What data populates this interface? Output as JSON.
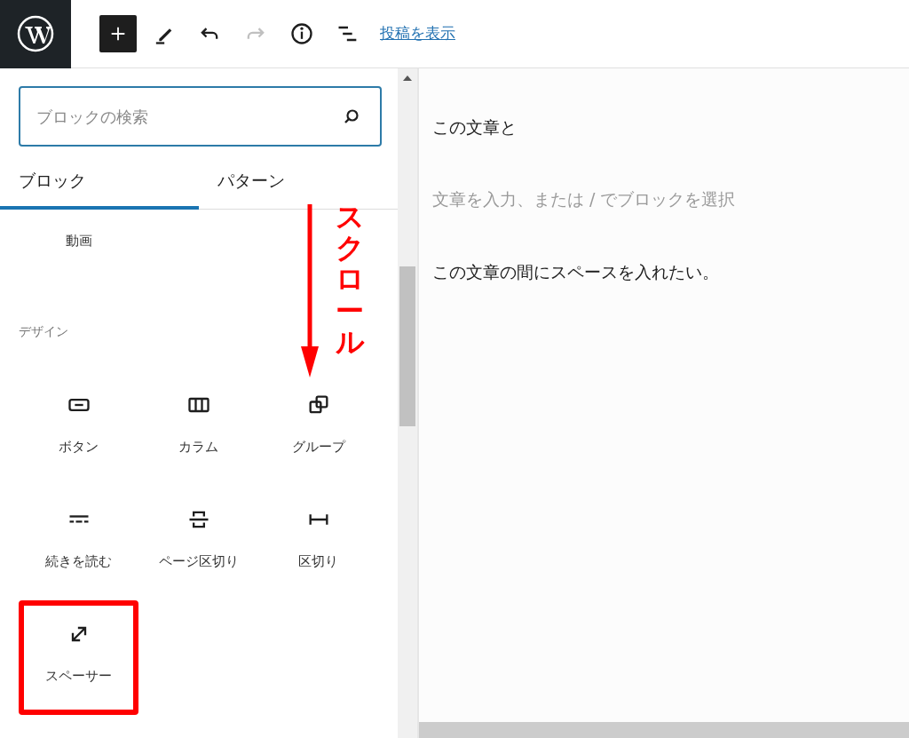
{
  "toolbar": {
    "buttons": [
      {
        "kind": "add",
        "disabled": false
      },
      {
        "kind": "edit",
        "disabled": false
      },
      {
        "kind": "undo",
        "disabled": false
      },
      {
        "kind": "redo",
        "disabled": true
      },
      {
        "kind": "info",
        "disabled": false
      },
      {
        "kind": "outline",
        "disabled": false
      }
    ],
    "view_post_link": "投稿を表示"
  },
  "sidebar": {
    "search": {
      "placeholder": "ブロックの検索"
    },
    "tabs": [
      {
        "label": "ブロック",
        "selected": true
      },
      {
        "label": "パターン",
        "selected": false
      }
    ],
    "partial_block": {
      "label": "動画"
    },
    "section": {
      "title": "デザイン",
      "blocks": [
        {
          "kind": "button",
          "label": "ボタン",
          "highlighted": false
        },
        {
          "kind": "columns",
          "label": "カラム",
          "highlighted": false
        },
        {
          "kind": "group",
          "label": "グループ",
          "highlighted": false
        },
        {
          "kind": "more",
          "label": "続きを読む",
          "highlighted": false
        },
        {
          "kind": "pagebreak",
          "label": "ページ区切り",
          "highlighted": false
        },
        {
          "kind": "separator",
          "label": "区切り",
          "highlighted": false
        },
        {
          "kind": "spacer",
          "label": "スペーサー",
          "highlighted": true
        }
      ]
    }
  },
  "annotation": {
    "text": "スクロール"
  },
  "editor": {
    "paragraphs": [
      {
        "kind": "text",
        "text": "この文章と"
      },
      {
        "kind": "placeholder",
        "text": "文章を入力、または / でブロックを選択"
      },
      {
        "kind": "text",
        "text": "この文章の間にスペースを入れたい。"
      }
    ]
  }
}
